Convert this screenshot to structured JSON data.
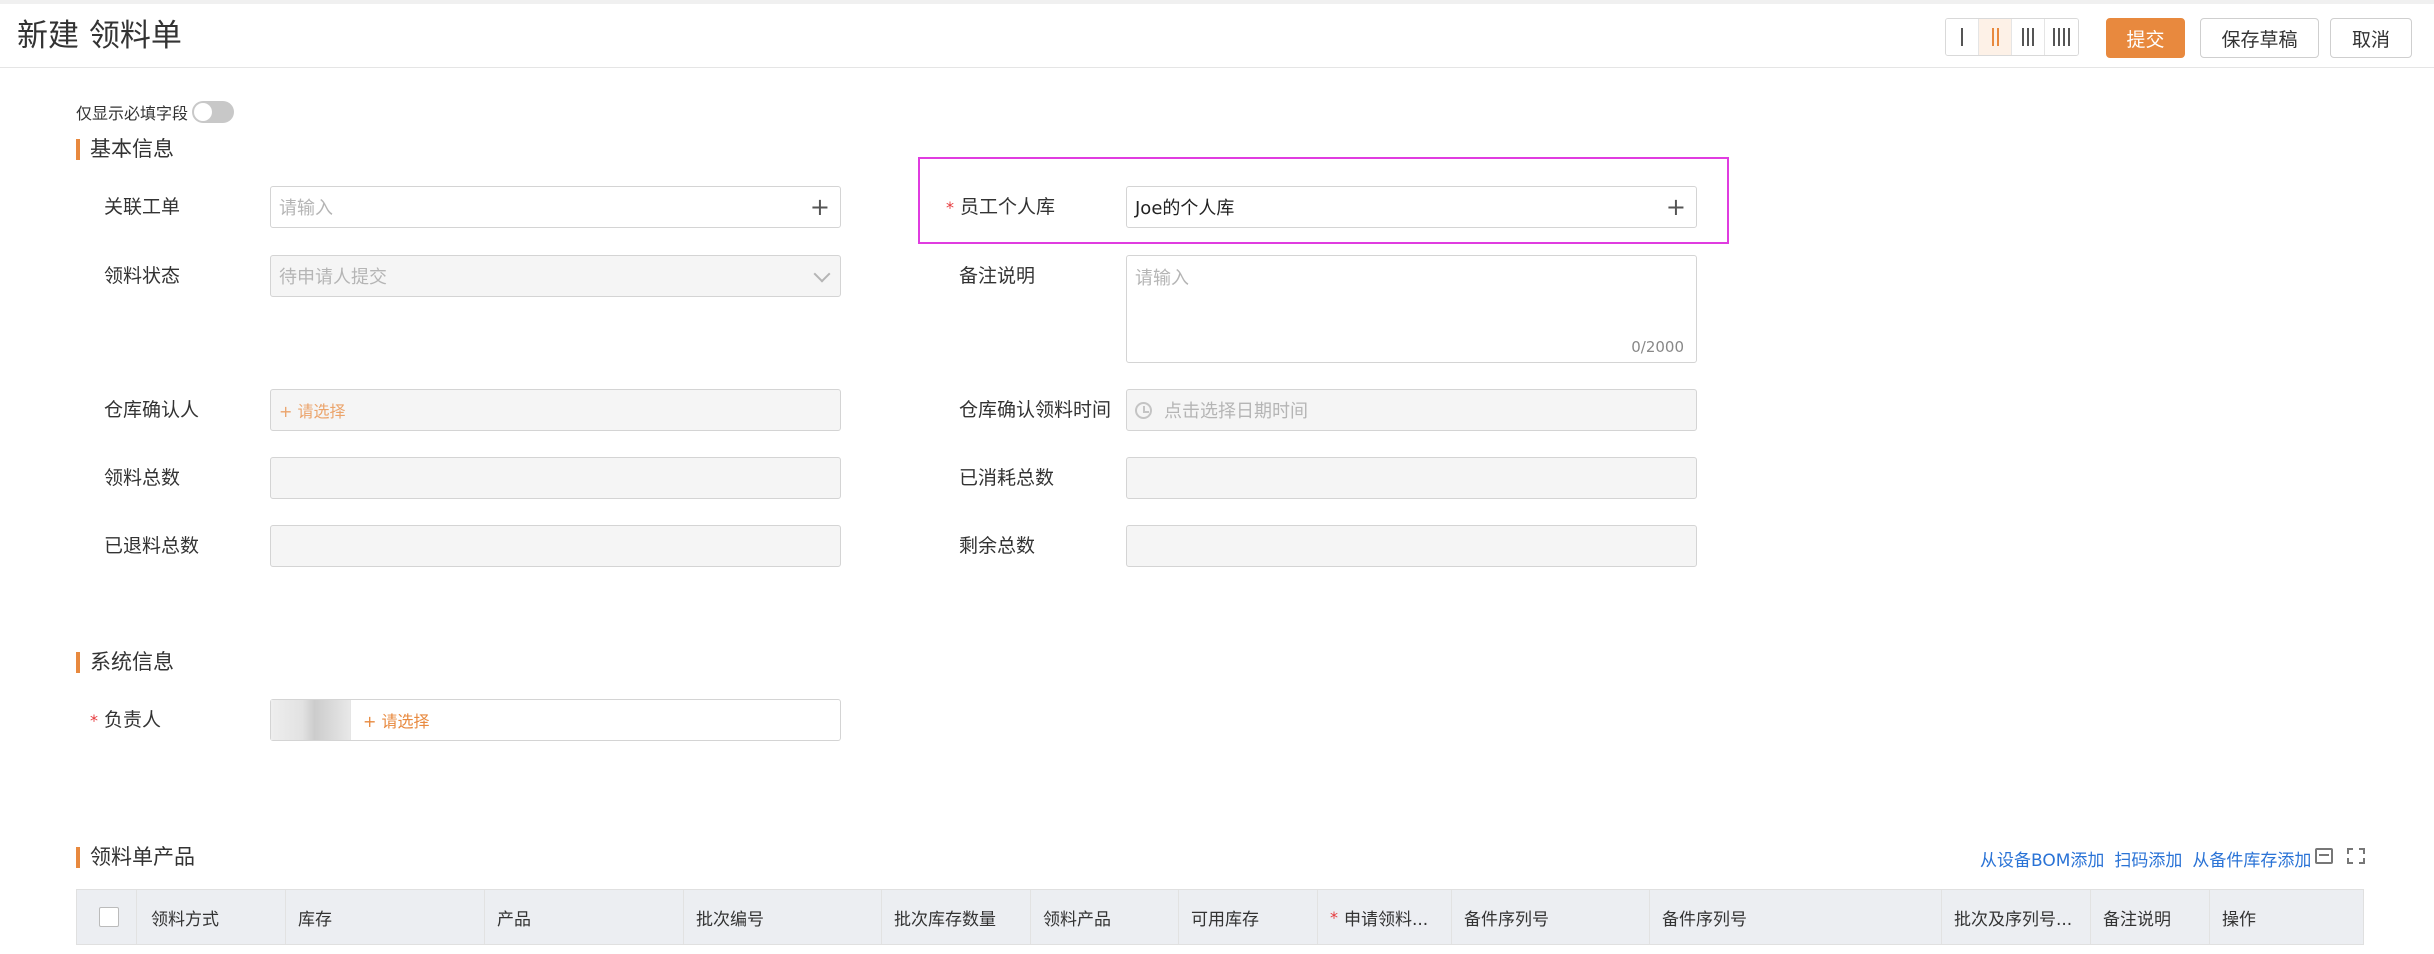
{
  "header": {
    "title": "新建 领料单",
    "layout_options": [
      "1-column",
      "2-column",
      "3-column",
      "4-column"
    ],
    "active_layout_index": 1,
    "submit_label": "提交",
    "draft_label": "保存草稿",
    "cancel_label": "取消"
  },
  "toggle": {
    "label": "仅显示必填字段",
    "on": false
  },
  "basic_info": {
    "title": "基本信息",
    "related_order": {
      "label": "关联工单",
      "placeholder": "请输入"
    },
    "status": {
      "label": "领料状态",
      "value": "待申请人提交"
    },
    "warehouse_confirmer": {
      "label": "仓库确认人",
      "value": "+ 请选择"
    },
    "total_requested": {
      "label": "领料总数",
      "value": ""
    },
    "total_returned": {
      "label": "已退料总数",
      "value": ""
    },
    "personal_warehouse": {
      "label": "员工个人库",
      "required": "*",
      "value": "Joe的个人库"
    },
    "remarks": {
      "label": "备注说明",
      "placeholder": "请输入",
      "counter": "0/2000"
    },
    "confirm_time": {
      "label": "仓库确认领料时间",
      "placeholder": "点击选择日期时间"
    },
    "total_consumed": {
      "label": "已消耗总数",
      "value": ""
    },
    "total_remaining": {
      "label": "剩余总数",
      "value": ""
    }
  },
  "system_info": {
    "title": "系统信息",
    "owner": {
      "label": "负责人",
      "required": "*",
      "select_label": "+ 请选择"
    }
  },
  "products": {
    "title": "领料单产品",
    "actions": [
      "从设备BOM添加",
      "扫码添加",
      "从备件库存添加"
    ],
    "columns": [
      "领料方式",
      "库存",
      "产品",
      "批次编号",
      "批次库存数量",
      "领料产品",
      "可用库存",
      "申请领料...",
      "备件序列号",
      "备件序列号",
      "批次及序列号...",
      "备注说明",
      "操作"
    ],
    "required_column_marker": "*"
  },
  "colors": {
    "accent": "#e8893e",
    "link": "#2a73d6",
    "highlight": "#e03ce0"
  }
}
